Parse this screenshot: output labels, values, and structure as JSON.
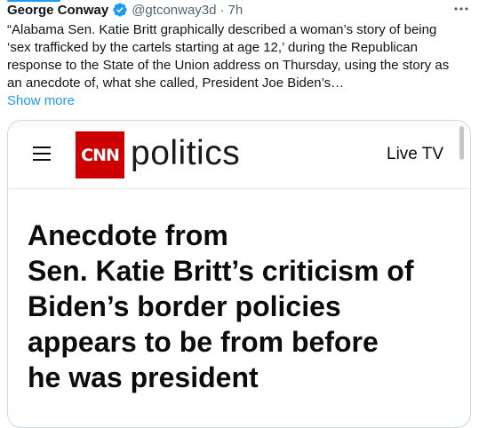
{
  "tweet": {
    "author_name": "George Conway",
    "handle": "@gtconway3d",
    "separator": "·",
    "time": "7h",
    "text_lines": [
      "“Alabama Sen. Katie Britt graphically described a woman’s story of being",
      "‘sex trafficked by the cartels starting at age 12,’ during the Republican",
      "response to the State of the Union address on Thursday, using the story as",
      "an anecdote of, what she called, President Joe Biden’s…"
    ],
    "show_more": "Show more"
  },
  "card": {
    "logo_text": "CNN",
    "section_name": "politics",
    "live_tv": "Live TV",
    "headline_lines": [
      "Anecdote from",
      "Sen. Katie Britt’s criticism of",
      "Biden’s border policies",
      "appears to be from before",
      "he was president"
    ]
  },
  "colors": {
    "accent": "#1d9bf0",
    "cnn_red": "#cc0000",
    "text": "#0f1419",
    "muted": "#536471"
  },
  "icons": [
    "verified-badge-icon",
    "more-options-icon",
    "hamburger-menu-icon"
  ]
}
